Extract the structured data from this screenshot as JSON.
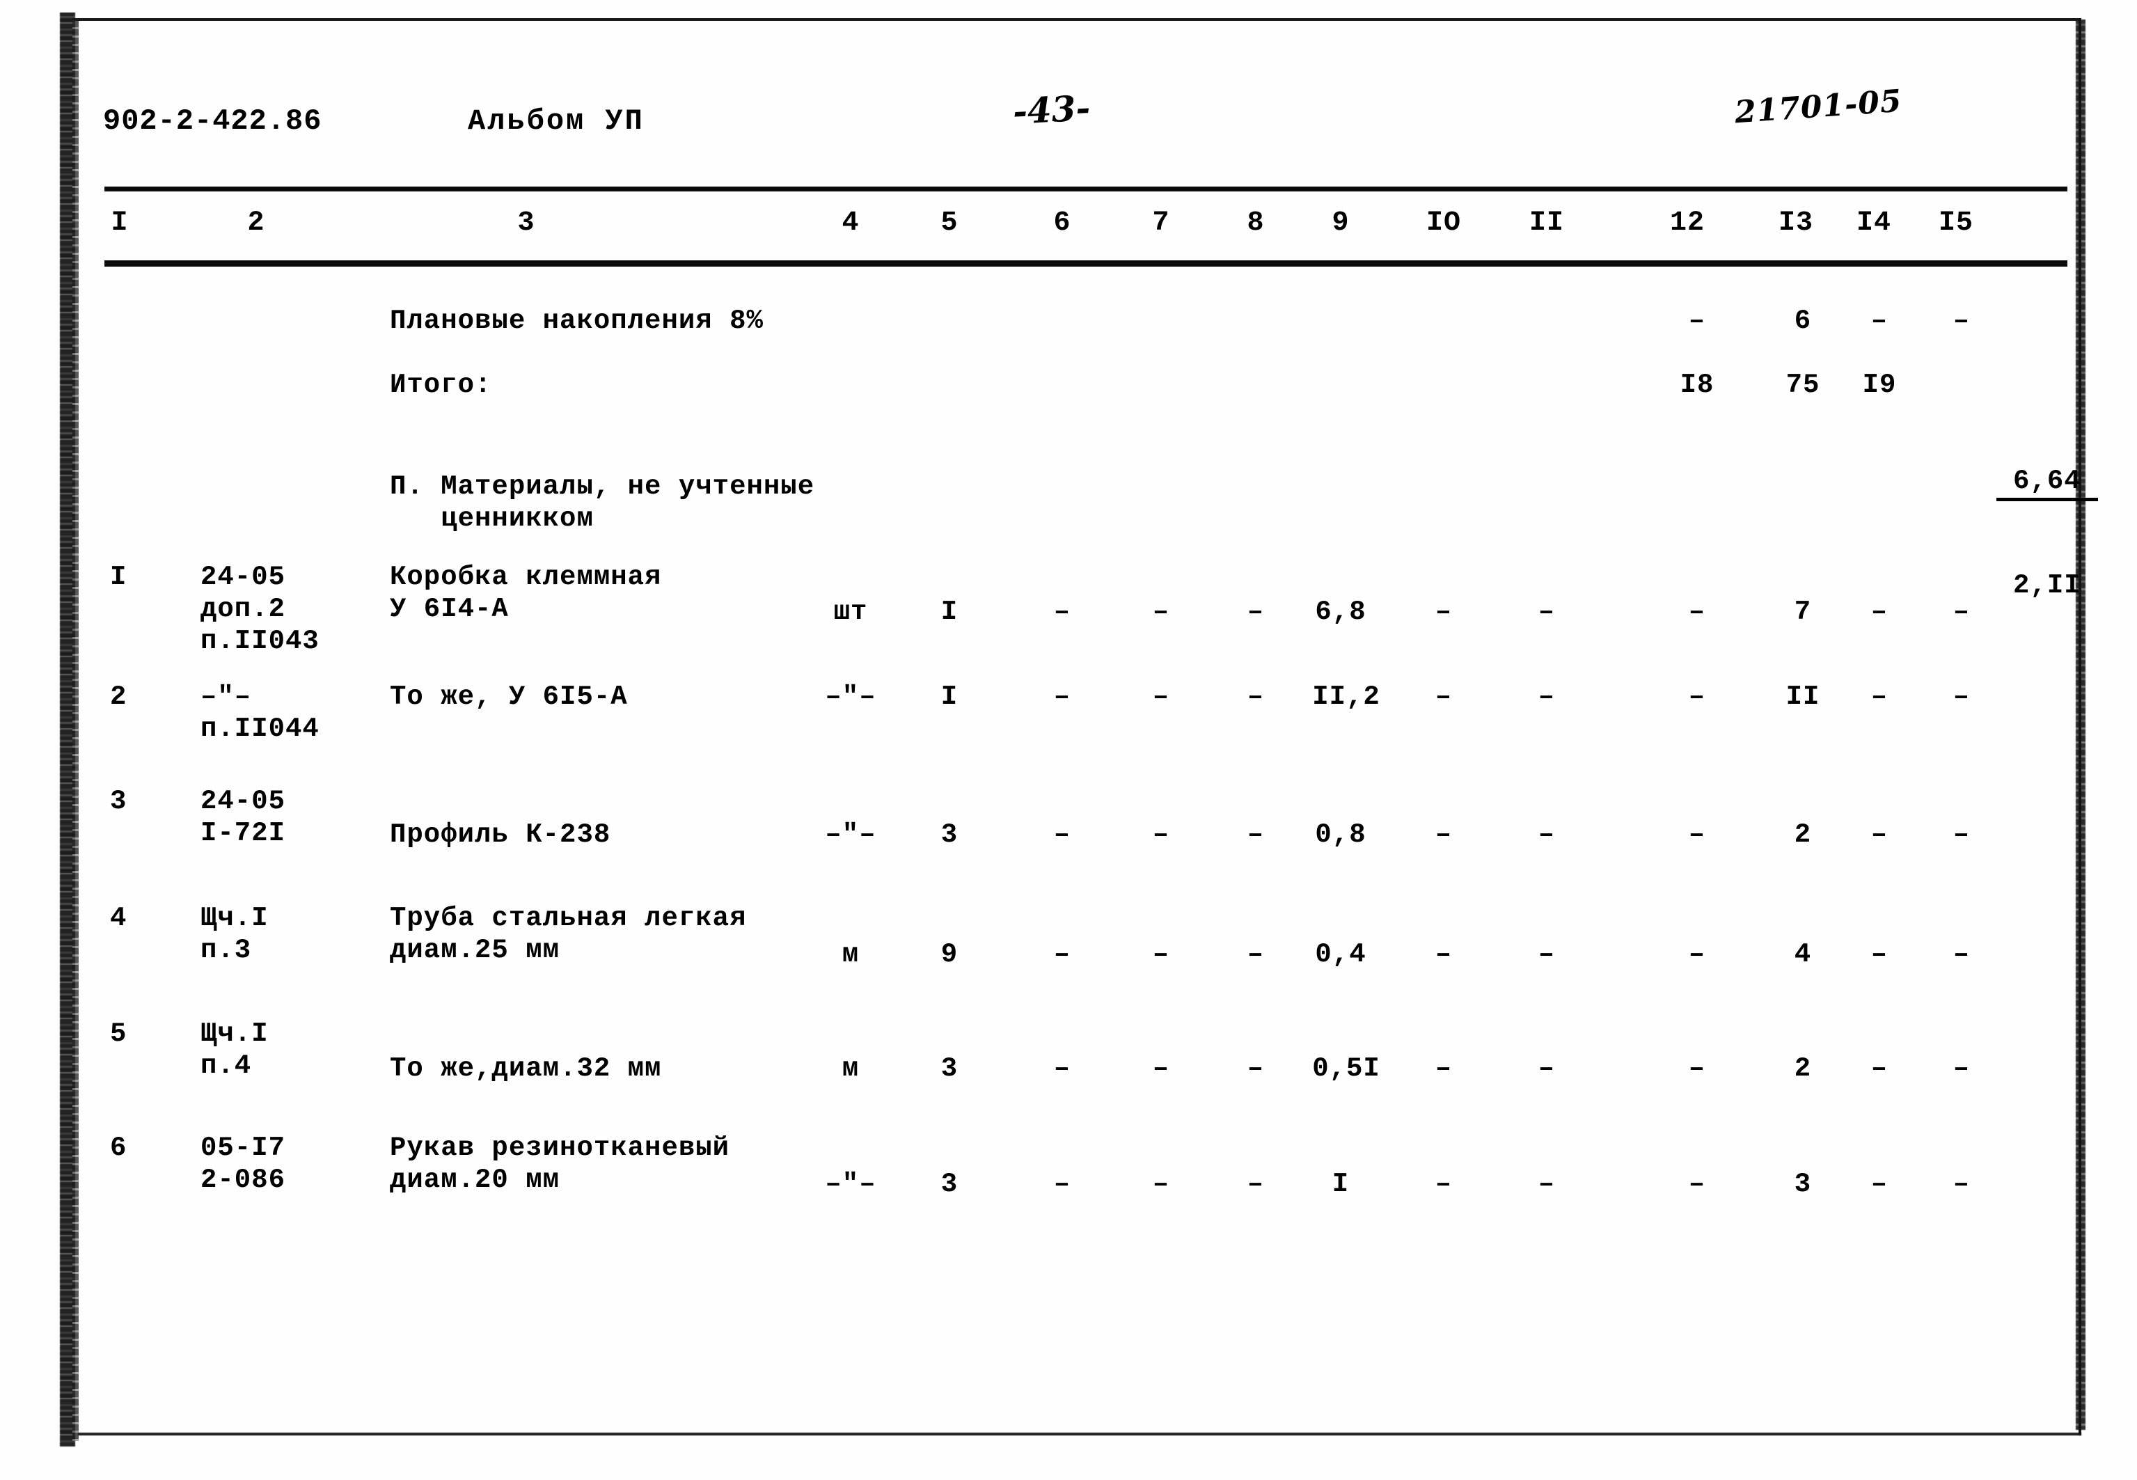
{
  "header": {
    "doc_code": "902-2-422.86",
    "album": "Альбом УП",
    "page_number": "-43-",
    "stamp": "21701-05"
  },
  "table": {
    "column_numbers": [
      "I",
      "2",
      "3",
      "4",
      "5",
      "6",
      "7",
      "8",
      "9",
      "IO",
      "II",
      "12",
      "I3",
      "I4",
      "I5"
    ],
    "rows": [
      {
        "num": "",
        "code": "",
        "name": "Плановые накопления 8%",
        "unit": "",
        "qty": "",
        "c6": "",
        "c7": "",
        "c8": "",
        "c9": "",
        "c10": "",
        "c11": "",
        "c12": "–",
        "c13": "6",
        "c14": "–",
        "c15": "–"
      },
      {
        "num": "",
        "code": "",
        "name": "Итого:",
        "unit": "",
        "qty": "",
        "c6": "",
        "c7": "",
        "c8": "",
        "c9": "",
        "c10": "",
        "c11": "",
        "c12": "I8",
        "c13": "75",
        "c14": "I9",
        "c15_num": "6,64",
        "c15_den": "2,II"
      },
      {
        "num": "",
        "code": "",
        "name": "П. Материалы, не учтенные\n   ценникком",
        "unit": "",
        "qty": "",
        "c6": "",
        "c7": "",
        "c8": "",
        "c9": "",
        "c10": "",
        "c11": "",
        "c12": "",
        "c13": "",
        "c14": "",
        "c15": ""
      },
      {
        "num": "I",
        "code": "24-05\nдоп.2\nп.II043",
        "name": "Коробка клеммная\nУ 6I4-А",
        "unit": "шт",
        "qty": "I",
        "c6": "–",
        "c7": "–",
        "c8": "–",
        "c9": "6,8",
        "c10": "–",
        "c11": "–",
        "c12": "–",
        "c13": "7",
        "c14": "–",
        "c15": "–"
      },
      {
        "num": "2",
        "code": "–\"–\nп.II044",
        "name": "То же, У 6I5-А",
        "unit": "–\"–",
        "qty": "I",
        "c6": "–",
        "c7": "–",
        "c8": "–",
        "c9": "II,2",
        "c10": "–",
        "c11": "–",
        "c12": "–",
        "c13": "II",
        "c14": "–",
        "c15": "–"
      },
      {
        "num": "3",
        "code": "24-05\nI-72I",
        "name": "Профиль К-238",
        "unit": "–\"–",
        "qty": "3",
        "c6": "–",
        "c7": "–",
        "c8": "–",
        "c9": "0,8",
        "c10": "–",
        "c11": "–",
        "c12": "–",
        "c13": "2",
        "c14": "–",
        "c15": "–"
      },
      {
        "num": "4",
        "code": "Щч.I\nп.3",
        "name": "Труба стальная легкая\nдиам.25 мм",
        "unit": "м",
        "qty": "9",
        "c6": "–",
        "c7": "–",
        "c8": "–",
        "c9": "0,4",
        "c10": "–",
        "c11": "–",
        "c12": "–",
        "c13": "4",
        "c14": "–",
        "c15": "–"
      },
      {
        "num": "5",
        "code": "Щч.I\nп.4",
        "name": "То же,диам.32 мм",
        "unit": "м",
        "qty": "3",
        "c6": "–",
        "c7": "–",
        "c8": "–",
        "c9": "0,5I",
        "c10": "–",
        "c11": "–",
        "c12": "–",
        "c13": "2",
        "c14": "–",
        "c15": "–"
      },
      {
        "num": "6",
        "code": "05-I7\n2-086",
        "name": "Рукав резинотканевый\nдиам.20 мм",
        "unit": "–\"–",
        "qty": "3",
        "c6": "–",
        "c7": "–",
        "c8": "–",
        "c9": "I",
        "c10": "–",
        "c11": "–",
        "c12": "–",
        "c13": "3",
        "c14": "–",
        "c15": "–"
      }
    ]
  }
}
